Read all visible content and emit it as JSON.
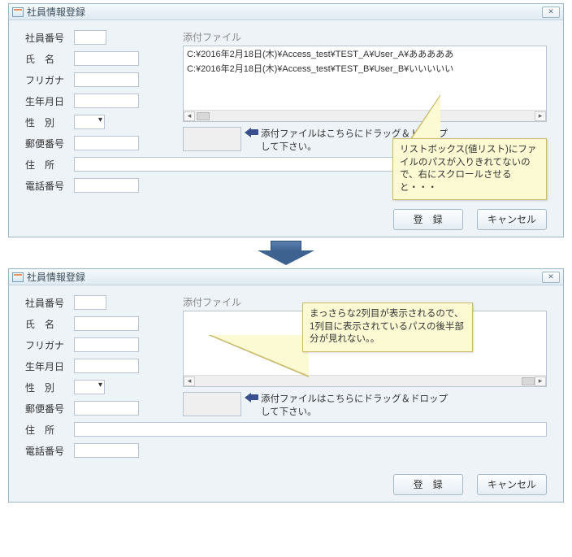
{
  "window": {
    "title": "社員情報登録",
    "close": "✕"
  },
  "labels": {
    "emp_no": "社員番号",
    "name": "氏　名",
    "kana": "フリガナ",
    "birth": "生年月日",
    "sex": "性　別",
    "postal": "郵便番号",
    "address": "住　所",
    "phone": "電話番号",
    "attach": "添付ファイル",
    "drop_text": "添付ファイルはこちらにドラッグ＆ドロップして下さい。"
  },
  "attachments_top": [
    "C:¥2016年2月18日(木)¥Access_test¥TEST_A¥User_A¥あああああ",
    "C:¥2016年2月18日(木)¥Access_test¥TEST_B¥User_B¥いいいいい"
  ],
  "buttons": {
    "register": "登　録",
    "cancel": "キャンセル"
  },
  "callouts": {
    "upper": "リストボックス(値リスト)にファイルのパスが入りきれてないので、右にスクロールさせると・・・",
    "lower": "まっさらな2列目が表示されるので、1列目に表示されているパスの後半部分が見れない。。"
  }
}
